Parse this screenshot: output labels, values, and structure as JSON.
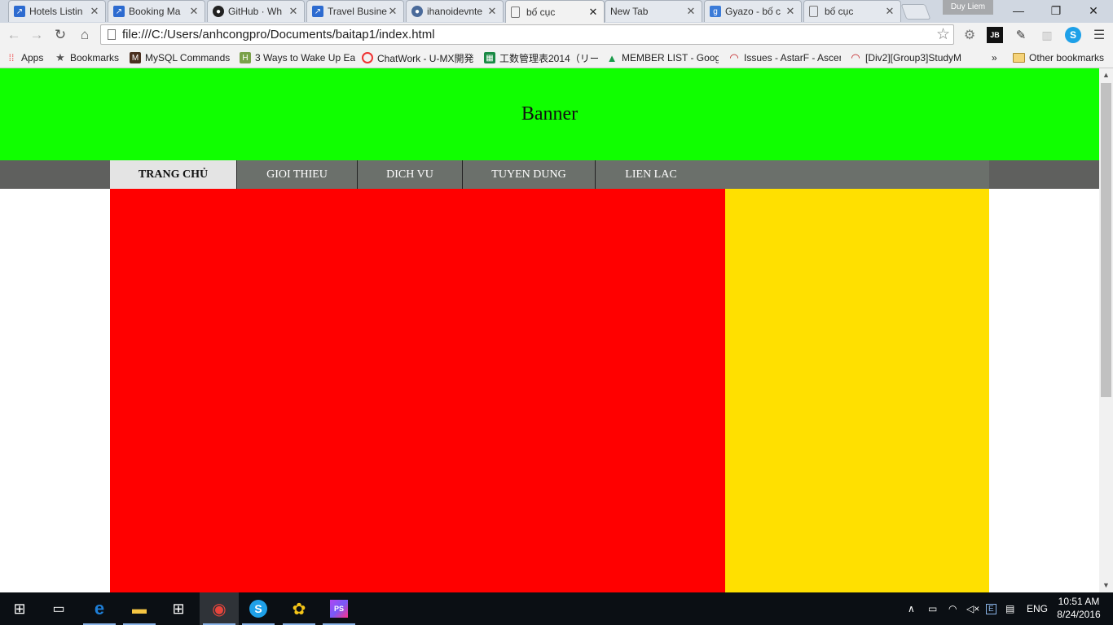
{
  "browser": {
    "tabs": [
      {
        "title": "Hotels Listin",
        "icon": "jira-icon"
      },
      {
        "title": "Booking Ma",
        "icon": "jira-icon"
      },
      {
        "title": "GitHub · Wh",
        "icon": "github-icon"
      },
      {
        "title": "Travel Busine",
        "icon": "jira-icon"
      },
      {
        "title": "ihanoidevnte",
        "icon": "discourse-icon"
      },
      {
        "title": "bố cục",
        "icon": "page-icon"
      },
      {
        "title": "New Tab",
        "icon": "none"
      },
      {
        "title": "Gyazo - bố c",
        "icon": "gyazo-icon"
      },
      {
        "title": "bố cục",
        "icon": "page-icon"
      }
    ],
    "active_tab_index": 5,
    "user_name": "Duy Liem",
    "url": "file:///C:/Users/anhcongpro/Documents/baitap1/index.html",
    "bookmarks": [
      {
        "label": "Apps",
        "icon": "apps-grid-icon"
      },
      {
        "label": "Bookmarks",
        "icon": "star-icon"
      },
      {
        "label": "MySQL Commands",
        "icon": "mysql-icon"
      },
      {
        "label": "3 Ways to Wake Up Ea",
        "icon": "wikihow-icon"
      },
      {
        "label": "ChatWork - U-MX開発",
        "icon": "chatwork-icon"
      },
      {
        "label": "工数管理表2014（リー",
        "icon": "sheets-icon"
      },
      {
        "label": "MEMBER LIST - Googl",
        "icon": "drive-icon"
      },
      {
        "label": "Issues - AstarF - Ascen",
        "icon": "redmine-icon"
      },
      {
        "label": "[Div2][Group3]StudyM",
        "icon": "redmine-icon"
      }
    ],
    "overflow_label": "»",
    "other_bookmarks": "Other bookmarks"
  },
  "page": {
    "banner_text": "Banner",
    "menu": [
      {
        "label": "TRANG CHỦ",
        "active": true
      },
      {
        "label": "GIOI THIEU",
        "active": false
      },
      {
        "label": "DICH VU",
        "active": false
      },
      {
        "label": "TUYEN DUNG",
        "active": false
      },
      {
        "label": "LIEN LAC",
        "active": false
      }
    ],
    "colors": {
      "banner": "#10ff00",
      "menu_bar": "#5f605e",
      "menu": "#6b706b",
      "main": "#ff0000",
      "sidebar": "#ffe000"
    }
  },
  "taskbar": {
    "time": "10:51 AM",
    "date": "8/24/2016",
    "language": "ENG",
    "apps": [
      "start-icon",
      "task-view-icon",
      "edge-icon",
      "file-explorer-icon",
      "store-icon",
      "chrome-icon",
      "skype-icon",
      "yellow-app-icon",
      "phpstorm-icon"
    ]
  }
}
